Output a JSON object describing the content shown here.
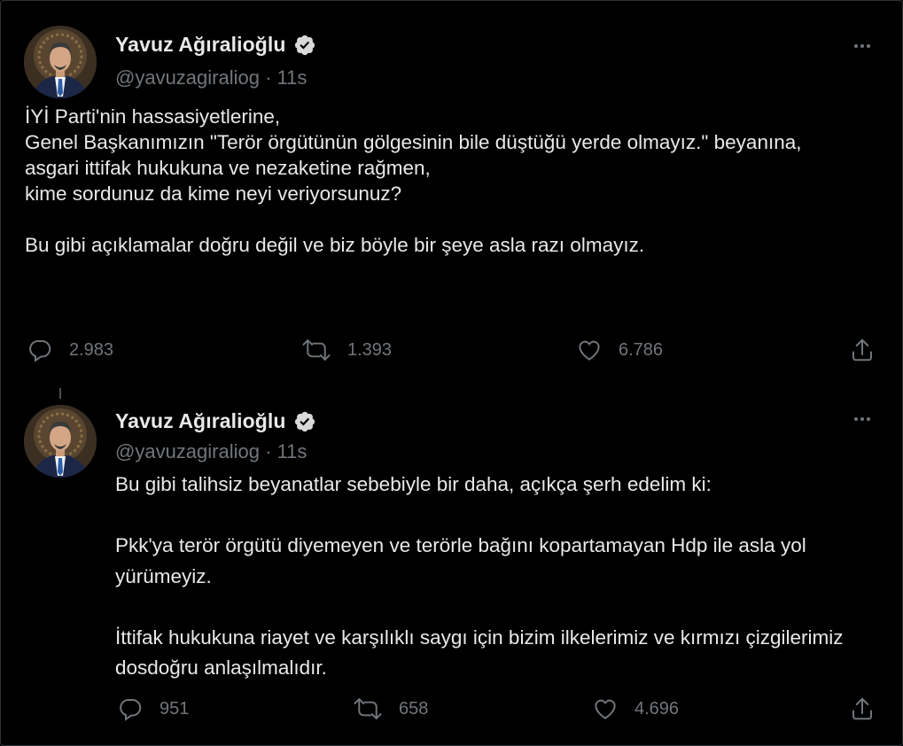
{
  "tweets": [
    {
      "author": {
        "name": "Yavuz Ağıralioğlu",
        "handle": "@yavuzagiraliog",
        "separator": "·",
        "time": "11s",
        "verified": true
      },
      "text": "İYİ Parti'nin hassasiyetlerine,\nGenel Başkanımızın \"Terör örgütünün gölgesinin bile düştüğü yerde olmayız.\" beyanına,\nasgari ittifak hukukuna ve nezaketine rağmen,\nkime sordunuz da kime neyi veriyorsunuz?\n\nBu gibi açıklamalar doğru değil ve biz böyle bir şeye asla razı olmayız.",
      "stats": {
        "replies": "2.983",
        "retweets": "1.393",
        "likes": "6.786"
      }
    },
    {
      "author": {
        "name": "Yavuz Ağıralioğlu",
        "handle": "@yavuzagiraliog",
        "separator": "·",
        "time": "11s",
        "verified": true
      },
      "text": "Bu gibi talihsiz beyanatlar sebebiyle bir daha, açıkça şerh edelim ki:\n\nPkk'ya terör örgütü diyemeyen ve terörle bağını kopartamayan Hdp ile asla yol yürümeyiz.\n\nİttifak hukukuna riayet ve karşılıklı saygı için bizim ilkelerimiz ve kırmızı çizgilerimiz dosdoğru anlaşılmalıdır.",
      "stats": {
        "replies": "951",
        "retweets": "658",
        "likes": "4.696"
      }
    }
  ],
  "icons": {
    "verified": "verified-badge-icon",
    "more": "more-horizontal-icon",
    "reply": "reply-icon",
    "retweet": "retweet-icon",
    "like": "like-icon",
    "share": "share-icon"
  },
  "colors": {
    "background": "#000000",
    "text_primary": "#e7e9ea",
    "text_secondary": "#71767b",
    "verified_badge": "#d9d9d9"
  }
}
